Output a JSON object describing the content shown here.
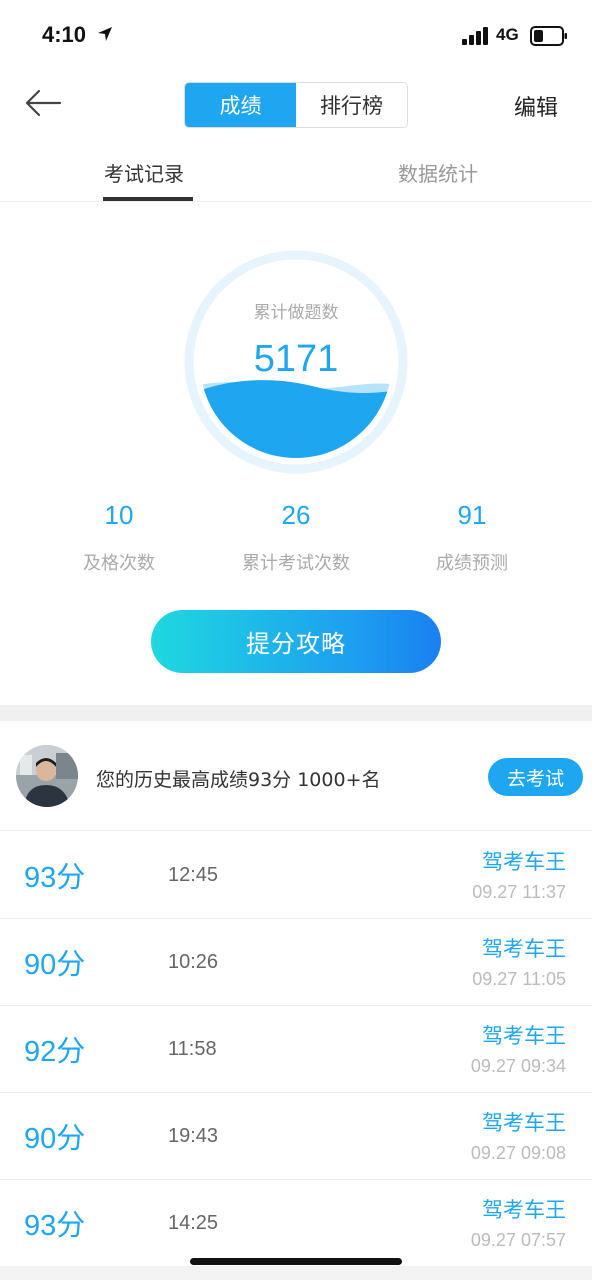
{
  "status_bar": {
    "time": "4:10",
    "network": "4G"
  },
  "nav": {
    "segments": [
      "成绩",
      "排行榜"
    ],
    "active_segment": "成绩",
    "edit_label": "编辑"
  },
  "tabs": {
    "records_label": "考试记录",
    "stats_label": "数据统计",
    "active": "考试记录"
  },
  "summary": {
    "gauge_label": "累计做题数",
    "gauge_value": "5171",
    "stats": [
      {
        "value": "10",
        "label": "及格次数"
      },
      {
        "value": "26",
        "label": "累计考试次数"
      },
      {
        "value": "91",
        "label": "成绩预测"
      }
    ],
    "boost_button": "提分攻略"
  },
  "best": {
    "text": "您的历史最高成绩93分  1000+名",
    "button": "去考试"
  },
  "records": [
    {
      "score": "93分",
      "duration": "12:45",
      "title": "驾考车王",
      "time": "09.27 11:37"
    },
    {
      "score": "90分",
      "duration": "10:26",
      "title": "驾考车王",
      "time": "09.27 11:05"
    },
    {
      "score": "92分",
      "duration": "11:58",
      "title": "驾考车王",
      "time": "09.27 09:34"
    },
    {
      "score": "90分",
      "duration": "19:43",
      "title": "驾考车王",
      "time": "09.27 09:08"
    },
    {
      "score": "93分",
      "duration": "14:25",
      "title": "驾考车王",
      "time": "09.27 07:57"
    }
  ],
  "colors": {
    "accent": "#1ea6f0",
    "gradient_start": "#1fd8e0",
    "gradient_end": "#1a80f0"
  }
}
